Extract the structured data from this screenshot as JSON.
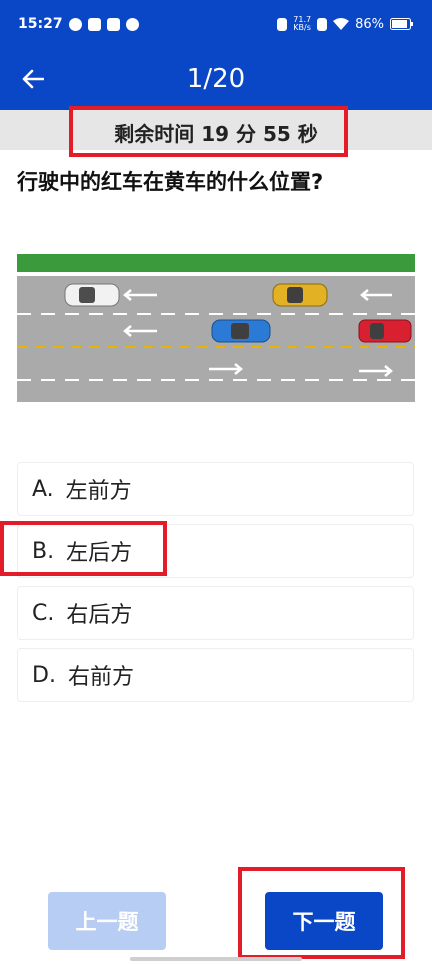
{
  "status_bar": {
    "time": "15:27",
    "net_speed_value": "71.7",
    "net_speed_unit": "KB/s",
    "battery": "86%"
  },
  "header": {
    "title": "1/20"
  },
  "timer": {
    "text": "剩余时间 19 分 55 秒"
  },
  "question": {
    "text": "行驶中的红车在黄车的什么位置?"
  },
  "options": [
    {
      "letter": "A.",
      "label": "左前方"
    },
    {
      "letter": "B.",
      "label": "左后方"
    },
    {
      "letter": "C.",
      "label": "右后方"
    },
    {
      "letter": "D.",
      "label": "右前方"
    }
  ],
  "buttons": {
    "prev": "上一题",
    "next": "下一题"
  },
  "colors": {
    "primary": "#0a47c7",
    "disabled": "#b7cdf3",
    "highlight": "#e31c2a",
    "red_car": "#d92030",
    "yellow_car": "#e2b224",
    "blue_car": "#2a7ad6",
    "white_car": "#f2f2f2"
  }
}
